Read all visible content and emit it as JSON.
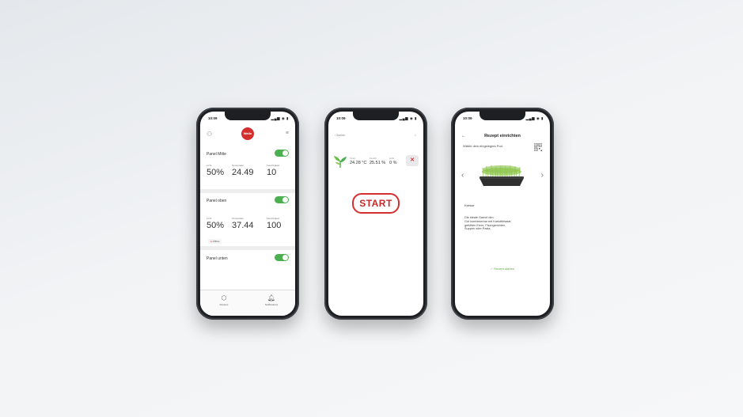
{
  "accent_color": "#d32f2f",
  "toggle_color": "#4caf50",
  "phone1": {
    "time": "10:09",
    "status_icons": "▂▄▆ ◉ ▮",
    "logo_text": "Wallo",
    "panels": [
      {
        "title": "Panel Mitte",
        "metrics": [
          {
            "label": "Licht",
            "value": "50%"
          },
          {
            "label": "Temperatur",
            "value": "24.49"
          },
          {
            "label": "Feuchtigkeit",
            "value": "10"
          }
        ]
      },
      {
        "title": "Panel oben",
        "metrics": [
          {
            "label": "Licht",
            "value": "50%"
          },
          {
            "label": "Temperatur",
            "value": "37.44"
          },
          {
            "label": "Feuchtigkeit",
            "value": "100"
          }
        ],
        "badge": "Offline"
      },
      {
        "title": "Panel unten",
        "metrics": []
      }
    ],
    "tabs": [
      {
        "label": "Devices"
      },
      {
        "label": "Notifications"
      }
    ]
  },
  "phone2": {
    "time": "10:09",
    "status_icons": "▂▄▆ ◉ ▮",
    "back_label": "‹ Zurück",
    "metrics": [
      {
        "label": "Temp",
        "value": "24.28 °C"
      },
      {
        "label": "Feucht",
        "value": "25.51 %"
      },
      {
        "label": "Licht",
        "value": "0 %"
      }
    ],
    "start_label": "START"
  },
  "phone3": {
    "time": "10:09",
    "status_icons": "▂▄▆ ◉ ▮",
    "title": "Rezept einrichten",
    "subtitle": "Wähle dein eingelegtes Pod",
    "plant_name": "Kresse",
    "description": [
      "Die ideale Garnel dim.",
      "Gut kombinierbar mit Kartoffelsalat,",
      "gefüllten Eiern, Fischgerichten,",
      "Suppen oder Pasta"
    ],
    "action_label": "✓ Rezept starten"
  }
}
